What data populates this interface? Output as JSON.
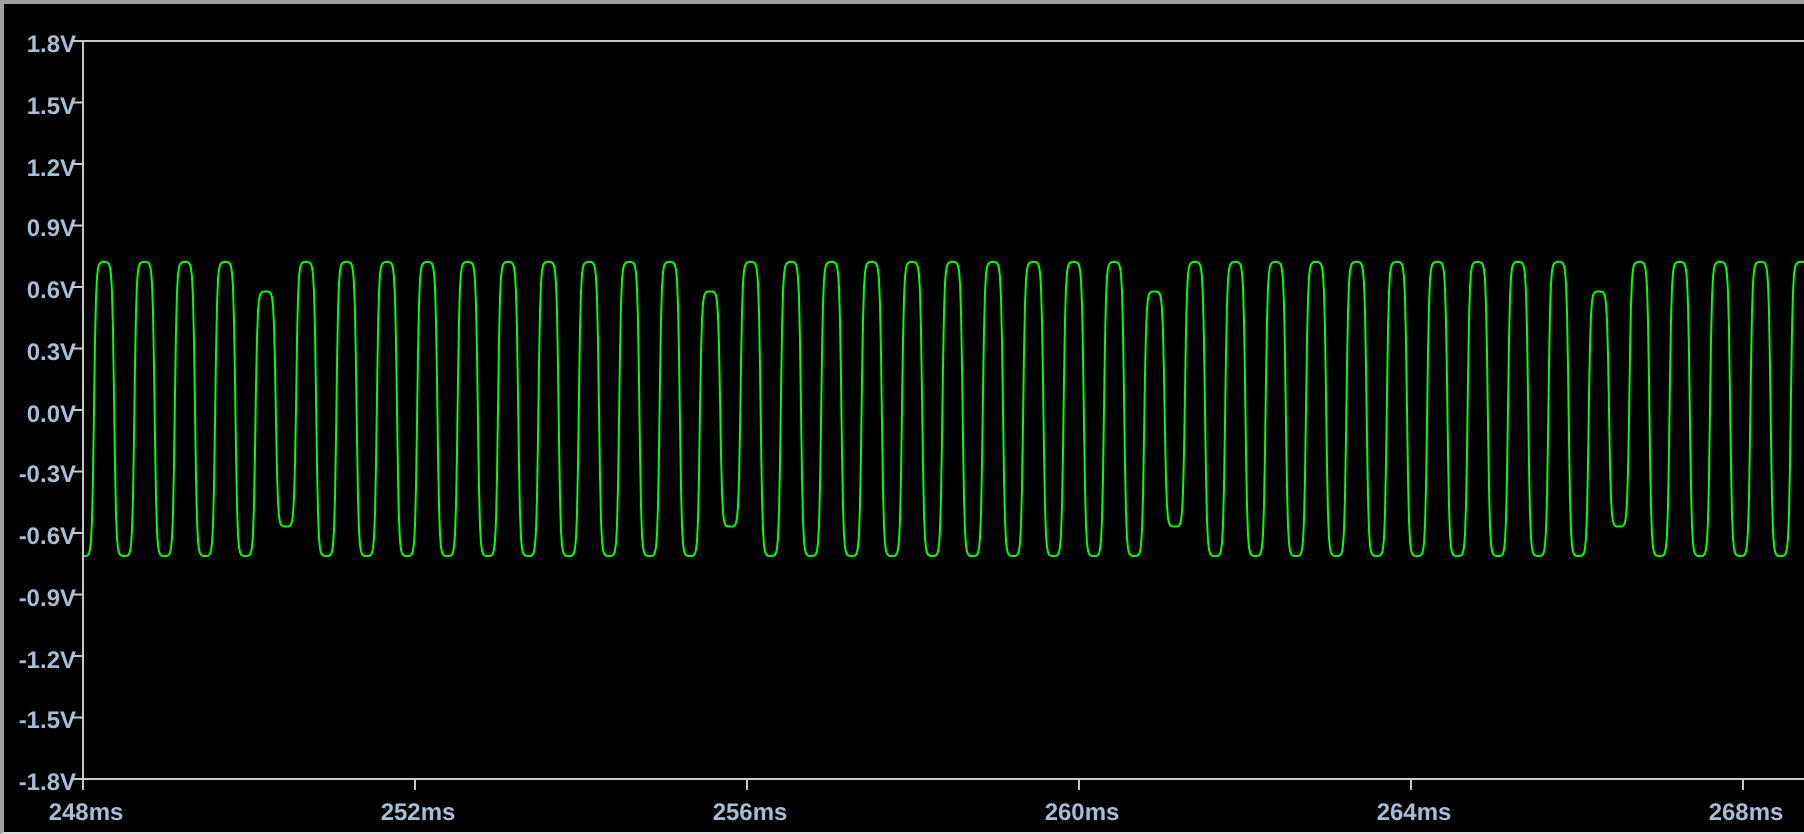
{
  "plot": {
    "y_ticks": [
      "1.8V",
      "1.5V",
      "1.2V",
      "0.9V",
      "0.6V",
      "0.3V",
      "0.0V",
      "-0.3V",
      "-0.6V",
      "-0.9V",
      "-1.2V",
      "-1.5V",
      "-1.8V"
    ],
    "x_ticks": [
      "248ms",
      "252ms",
      "256ms",
      "260ms",
      "264ms",
      "268ms"
    ]
  }
}
